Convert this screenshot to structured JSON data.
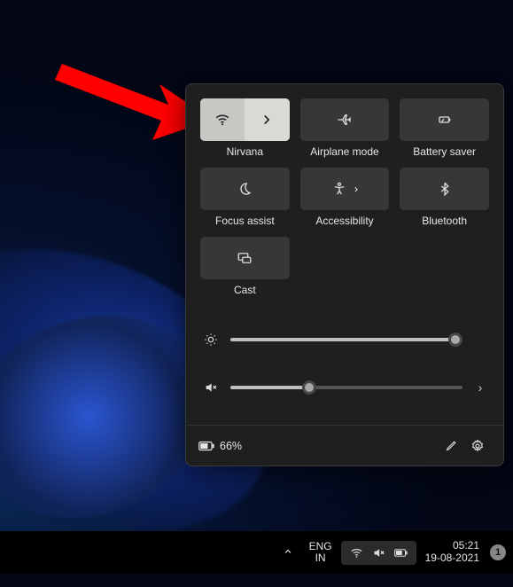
{
  "annotation": {
    "arrow_target": "wifi-tile"
  },
  "panel": {
    "tiles": [
      {
        "id": "wifi",
        "label": "Nirvana",
        "active": true,
        "split": true
      },
      {
        "id": "airplane",
        "label": "Airplane mode",
        "active": false
      },
      {
        "id": "battery-saver",
        "label": "Battery saver",
        "active": false
      },
      {
        "id": "focus-assist",
        "label": "Focus assist",
        "active": false
      },
      {
        "id": "accessibility",
        "label": "Accessibility",
        "active": false,
        "expandable": true
      },
      {
        "id": "bluetooth",
        "label": "Bluetooth",
        "active": false
      },
      {
        "id": "cast",
        "label": "Cast",
        "active": false
      }
    ],
    "brightness": {
      "percent": 97
    },
    "volume": {
      "percent": 34,
      "muted": true
    },
    "battery": {
      "percent_text": "66%"
    }
  },
  "taskbar": {
    "language": {
      "top": "ENG",
      "bottom": "IN"
    },
    "clock": {
      "time": "05:21",
      "date": "19-08-2021"
    },
    "notifications": "1"
  }
}
